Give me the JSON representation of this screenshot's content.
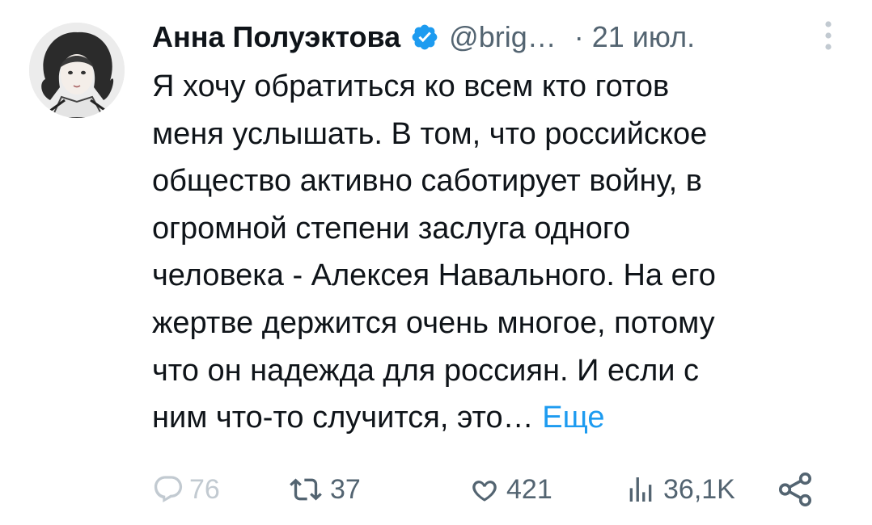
{
  "author": {
    "name": "Анна Полуэктова",
    "handle": "@brig…",
    "separator": "·",
    "date": "21 июл."
  },
  "tweet": {
    "text": "Я хочу обратиться ко всем кто готов\nменя услышать. В том, что российское\nобщество активно саботирует войну, в\nогромной степени заслуга одного\nчеловека - Алексея Навального. На его\nжертве держится очень многое, потому\nчто он надежда для россиян. И если с\nним что-то случится, это…",
    "show_more": "Еще"
  },
  "actions": {
    "replies": "76",
    "retweets": "37",
    "likes": "421",
    "views": "36,1K"
  },
  "icons": [
    "verified-badge-icon",
    "more-options-icon",
    "reply-icon",
    "retweet-icon",
    "like-icon",
    "views-icon",
    "share-icon"
  ],
  "colors": {
    "text": "#0f1419",
    "secondary": "#536471",
    "accent": "#1d9bf0"
  }
}
